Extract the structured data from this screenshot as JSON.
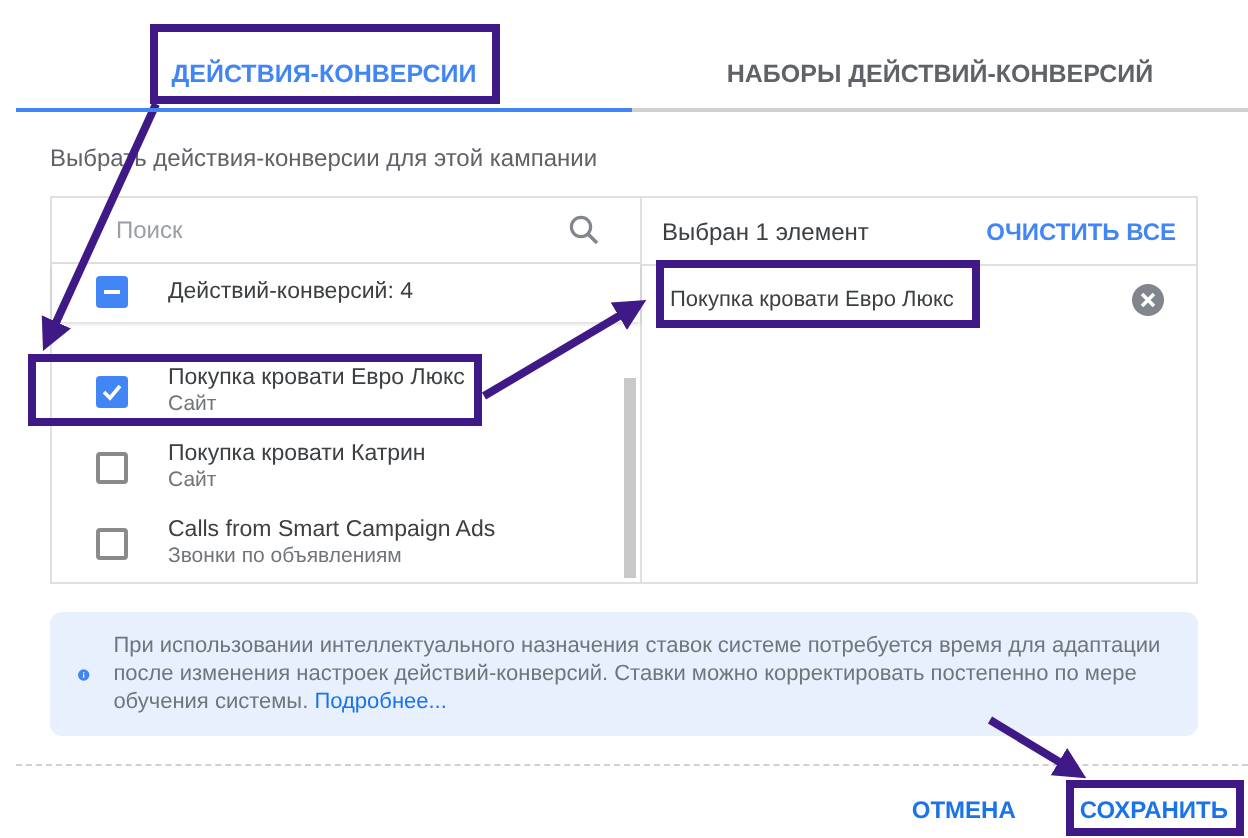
{
  "tabs": [
    {
      "label": "ДЕЙСТВИЯ-КОНВЕРСИИ",
      "selected": true
    },
    {
      "label": "НАБОРЫ ДЕЙСТВИЙ-КОНВЕРСИЙ",
      "selected": false
    }
  ],
  "subtitle": "Выбрать действия-конверсии для этой кампании",
  "search": {
    "placeholder": "Поиск"
  },
  "group": {
    "label": "Действий-конверсий: 4",
    "partial": true
  },
  "items": [
    {
      "title": "Покупка кровати Евро Люкс",
      "subtitle": "Сайт",
      "checked": true
    },
    {
      "title": "Покупка кровати Катрин",
      "subtitle": "Сайт",
      "checked": false
    },
    {
      "title": "Calls from Smart Campaign Ads",
      "subtitle": "Звонки по объявлениям",
      "checked": false
    }
  ],
  "selected_header": "Выбран 1 элемент",
  "clear_button": "ОЧИСТИТЬ ВСЕ",
  "selected_items": [
    {
      "label": "Покупка кровати Евро Люкс"
    }
  ],
  "info": {
    "text": "При использовании интеллектуального назначения ставок системе потребуется время для адаптации после изменения настроек действий-конверсий. Ставки можно корректировать постепенно по мере обучения системы.",
    "link": "Подробнее..."
  },
  "buttons": [
    {
      "label": "ОТМЕНА"
    },
    {
      "label": "СОХРАНИТЬ"
    }
  ]
}
